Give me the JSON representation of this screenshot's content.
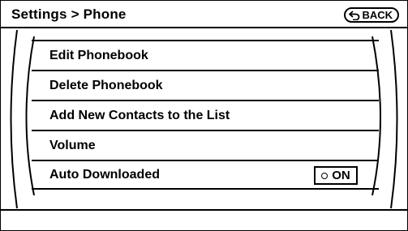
{
  "header": {
    "title": "Settings > Phone",
    "back_label": "BACK"
  },
  "menu": {
    "items": [
      {
        "label": "Edit Phonebook"
      },
      {
        "label": "Delete Phonebook"
      },
      {
        "label": "Add New Contacts to the List"
      },
      {
        "label": "Volume"
      },
      {
        "label": "Auto Downloaded",
        "toggle": "ON"
      }
    ]
  },
  "icons": {
    "back": "back-arrow-icon",
    "toggle": "indicator-dot-icon"
  },
  "colors": {
    "foreground": "#000000",
    "background": "#ffffff"
  }
}
